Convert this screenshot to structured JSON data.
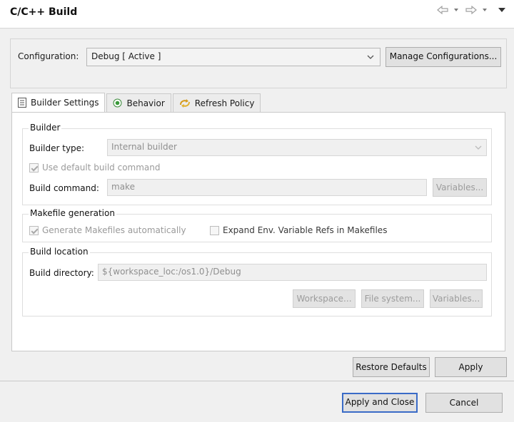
{
  "header": {
    "title": "C/C++ Build"
  },
  "configuration": {
    "label": "Configuration:",
    "value": "Debug  [ Active ]",
    "manage_button": "Manage Configurations..."
  },
  "tabs": [
    {
      "label": "Builder Settings",
      "icon": "builder-settings-icon"
    },
    {
      "label": "Behavior",
      "icon": "behavior-radio-icon"
    },
    {
      "label": "Refresh Policy",
      "icon": "refresh-policy-icon"
    }
  ],
  "builder": {
    "title": "Builder",
    "builder_type_label": "Builder type:",
    "builder_type_value": "Internal builder",
    "use_default_label": "Use default build command",
    "build_command_label": "Build command:",
    "build_command_value": "make",
    "variables_button": "Variables..."
  },
  "makefile": {
    "title": "Makefile generation",
    "generate_label": "Generate Makefiles automatically",
    "expand_label": "Expand Env. Variable Refs in Makefiles"
  },
  "location": {
    "title": "Build location",
    "directory_label": "Build directory:",
    "directory_value": "${workspace_loc:/os1.0}/Debug",
    "workspace_button": "Workspace...",
    "filesystem_button": "File system...",
    "variables_button": "Variables..."
  },
  "actions": {
    "restore_defaults": "Restore Defaults",
    "apply": "Apply",
    "apply_and_close": "Apply and Close",
    "cancel": "Cancel"
  }
}
